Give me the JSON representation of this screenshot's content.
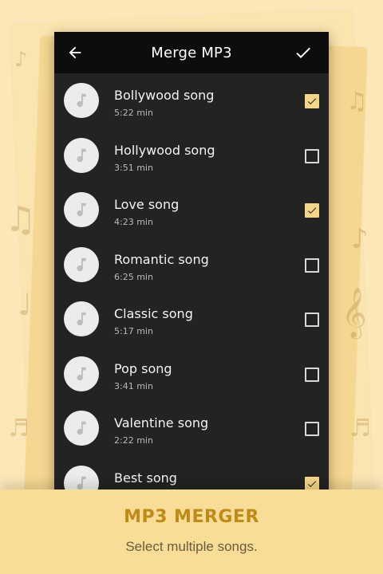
{
  "appbar": {
    "title": "Merge MP3",
    "back_icon": "arrow-left-icon",
    "done_icon": "check-icon"
  },
  "songs": [
    {
      "title": "Bollywood song",
      "duration": "5:22 min",
      "checked": true
    },
    {
      "title": "Hollywood song",
      "duration": "3:51 min",
      "checked": false
    },
    {
      "title": "Love song",
      "duration": "4:23 min",
      "checked": true
    },
    {
      "title": "Romantic song",
      "duration": "6:25 min",
      "checked": false
    },
    {
      "title": "Classic song",
      "duration": "5:17 min",
      "checked": false
    },
    {
      "title": "Pop song",
      "duration": "3:41 min",
      "checked": false
    },
    {
      "title": "Valentine song",
      "duration": "2:22 min",
      "checked": false
    },
    {
      "title": "Best song",
      "duration": "",
      "checked": true
    }
  ],
  "footer": {
    "headline": "MP3 MERGER",
    "subtitle": "Select multiple songs."
  },
  "colors": {
    "background": "#fbe7b8",
    "toolbar": "#0d0d0d",
    "list_background": "#232323",
    "accent": "#f6d686",
    "footer_headline": "#c08a17"
  }
}
